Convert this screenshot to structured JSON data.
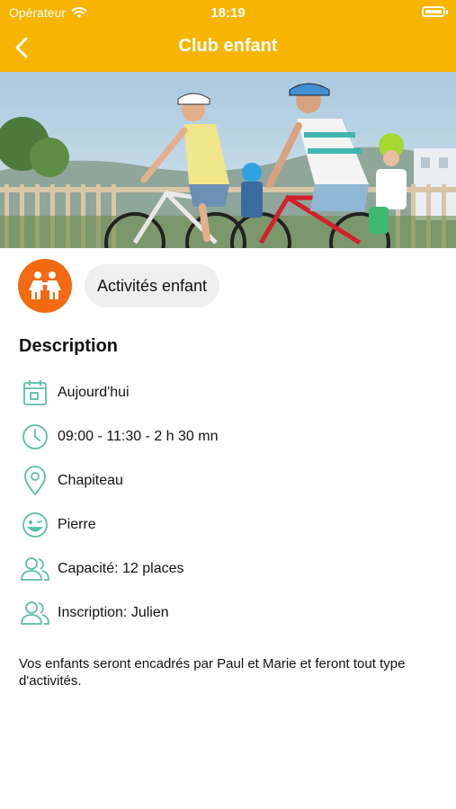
{
  "status_bar": {
    "carrier": "Opérateur",
    "time": "18:19"
  },
  "header": {
    "title": "Club enfant"
  },
  "category": {
    "label": "Activités enfant",
    "color": "#F26A12"
  },
  "description": {
    "heading": "Description",
    "items": [
      {
        "icon": "calendar-icon",
        "text": "Aujourd'hui"
      },
      {
        "icon": "clock-icon",
        "text": "09:00 - 11:30 - 2 h 30 mn"
      },
      {
        "icon": "location-pin-icon",
        "text": "Chapiteau"
      },
      {
        "icon": "smiley-icon",
        "text": "Pierre"
      },
      {
        "icon": "users-icon",
        "text": "Capacité: 12 places"
      },
      {
        "icon": "users-icon",
        "text": "Inscription: Julien"
      }
    ],
    "body": "Vos enfants seront encadrés par Paul et Marie et feront tout type d'activités."
  },
  "colors": {
    "header": "#F7B400",
    "icon_accent": "#5BBFA8"
  }
}
